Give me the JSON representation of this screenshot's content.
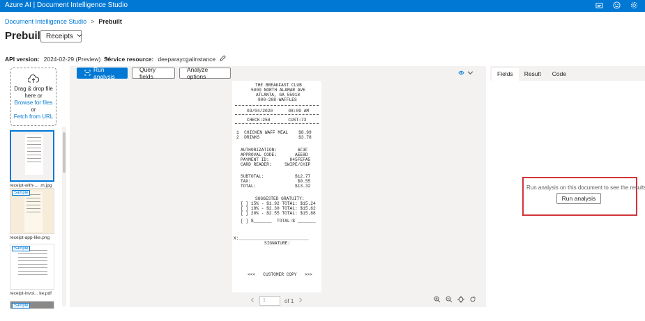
{
  "header": {
    "title": "Azure AI | Document Intelligence Studio",
    "icons": [
      "feedback-icon",
      "smiley-icon",
      "gear-icon"
    ]
  },
  "breadcrumb": {
    "root": "Document Intelligence Studio",
    "separator": ">",
    "current": "Prebuilt"
  },
  "page": {
    "title": "Prebuilt",
    "model_selected": "Receipts"
  },
  "meta": {
    "api_label": "API version:",
    "api_value": "2024-02-29 (Preview)",
    "service_label": "Service resource:",
    "service_value": "deeparaycgaiinstance"
  },
  "upload": {
    "line1": "Drag & drop file",
    "line2": "here or",
    "browse": "Browse for files",
    "or": "or",
    "fetch": "Fetch from URL"
  },
  "thumbnails": [
    {
      "caption": "receipt-with-... .m.jpg",
      "badge": ""
    },
    {
      "caption": "receipt-app-like.png",
      "badge": "Sample"
    },
    {
      "caption": "receipt-invoi... ke.pdf",
      "badge": "Sample"
    },
    {
      "caption": "",
      "badge": "Sample"
    }
  ],
  "toolbar": {
    "run": "Run analysis",
    "query": "Query fields",
    "options": "Analyze options"
  },
  "receipt": {
    "lines": [
      "THE BREAKFAST CLUB",
      "5000 NORTH ALAMAR AVE",
      "ATLANTA, GA 55918",
      "800-288-WAFFLES",
      "03/04/2020      08:09 AM",
      "CHECK:258       CUST:73",
      "1  CHICKEN WAFF MEAL    $8.99",
      "2  DRINKS               $3.78",
      "AUTHORIZATION:        6F3F",
      "APPROVAL CODE:       AEE8D",
      "PAYMENT ID:        845FEFA5",
      "CARD READER:     SWIPE/CHIP",
      "SUBTOTAL:            $12.77",
      "TAX:                  $0.55",
      "TOTAL:               $13.32",
      "SUGGESTED GRATUITY:",
      "[ ] 15% - $1.92 TOTAL: $15.24",
      "[ ] 18% - $2.30 TOTAL: $15.62",
      "[ ] 20% - $2.55 TOTAL: $15.88",
      "[ ] $_______  TOTAL:$ _______",
      "X:___________________________",
      "SIGNATURE:",
      "<<<   CUSTOMER COPY   >>>"
    ]
  },
  "pager": {
    "page": "1",
    "of": "of 1"
  },
  "results": {
    "tabs": [
      "Fields",
      "Result",
      "Code"
    ],
    "active_tab": "Fields",
    "message": "Run analysis on this document to see the results",
    "run": "Run analysis"
  },
  "colors": {
    "accent": "#0078d4",
    "highlight": "#d13438"
  }
}
